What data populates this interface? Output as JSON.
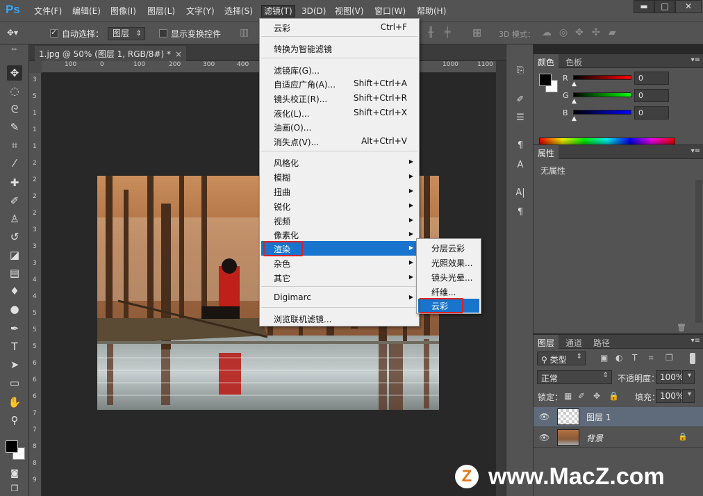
{
  "app": {
    "logo": "Ps"
  },
  "menubar": {
    "items": [
      "文件(F)",
      "编辑(E)",
      "图像(I)",
      "图层(L)",
      "文字(Y)",
      "选择(S)",
      "滤镜(T)",
      "3D(D)",
      "视图(V)",
      "窗口(W)",
      "帮助(H)"
    ],
    "active": "滤镜(T)"
  },
  "window_controls": {
    "minimize": "▬",
    "maximize": "□",
    "close": "✕"
  },
  "options_bar": {
    "auto_select_label": "自动选择：",
    "auto_select_checked": true,
    "auto_select_target": "图层",
    "show_transform_label": "显示变换控件",
    "mode_3d_label": "3D 模式："
  },
  "document": {
    "tab_title": "1.jpg @ 50% (图层 1, RGB/8#) *",
    "close_glyph": "×"
  },
  "rulers": {
    "h_ticks": [
      "100",
      "0",
      "100",
      "200",
      "300",
      "400",
      "1000",
      "1100"
    ],
    "v_ticks": [
      "3",
      "5",
      "1",
      "1",
      "1",
      "2",
      "2",
      "2",
      "2",
      "3",
      "3",
      "3",
      "4",
      "4",
      "5",
      "5",
      "5",
      "6",
      "6",
      "6",
      "7",
      "7",
      "8",
      "8",
      "9"
    ]
  },
  "filter_menu": {
    "items": [
      {
        "label": "云彩",
        "shortcut": "Ctrl+F"
      },
      {
        "label": "转换为智能滤镜"
      },
      {
        "label": "滤镜库(G)..."
      },
      {
        "label": "自适应广角(A)...",
        "shortcut": "Shift+Ctrl+A"
      },
      {
        "label": "镜头校正(R)...",
        "shortcut": "Shift+Ctrl+R"
      },
      {
        "label": "液化(L)...",
        "shortcut": "Shift+Ctrl+X"
      },
      {
        "label": "油画(O)..."
      },
      {
        "label": "消失点(V)...",
        "shortcut": "Alt+Ctrl+V"
      },
      {
        "label": "风格化"
      },
      {
        "label": "模糊"
      },
      {
        "label": "扭曲"
      },
      {
        "label": "锐化"
      },
      {
        "label": "视频"
      },
      {
        "label": "像素化"
      },
      {
        "label": "渲染",
        "highlighted": true
      },
      {
        "label": "杂色"
      },
      {
        "label": "其它"
      },
      {
        "label": "Digimarc"
      },
      {
        "label": "浏览联机滤镜..."
      }
    ],
    "arrow_glyph": "▶",
    "highlight_color": "#1874cd",
    "annotation_color": "#e02020"
  },
  "render_submenu": {
    "items": [
      "分层云彩",
      "光照效果...",
      "镜头光晕...",
      "纤维...",
      "云彩"
    ],
    "highlighted": "云彩"
  },
  "color_panel": {
    "tabs": [
      "颜色",
      "色板"
    ],
    "channels": [
      {
        "label": "R",
        "value": "0",
        "color": "#ff0000"
      },
      {
        "label": "G",
        "value": "0",
        "color": "#00ff00"
      },
      {
        "label": "B",
        "value": "0",
        "color": "#0000ff"
      }
    ],
    "foreground": "#000000",
    "background": "#ffffff"
  },
  "properties_panel": {
    "tab": "属性",
    "empty_text": "无属性"
  },
  "layers_panel": {
    "tabs": [
      "图层",
      "通道",
      "路径"
    ],
    "filter_kind": "类型",
    "blend_mode": "正常",
    "opacity_label": "不透明度：",
    "opacity_value": "100%",
    "lock_label": "锁定：",
    "fill_label": "填充：",
    "fill_value": "100%",
    "layers": [
      {
        "name": "图层 1",
        "selected": true
      },
      {
        "name": "背景",
        "locked": true
      }
    ]
  },
  "watermark": {
    "logo": "Z",
    "text": "www.MacZ.com"
  }
}
